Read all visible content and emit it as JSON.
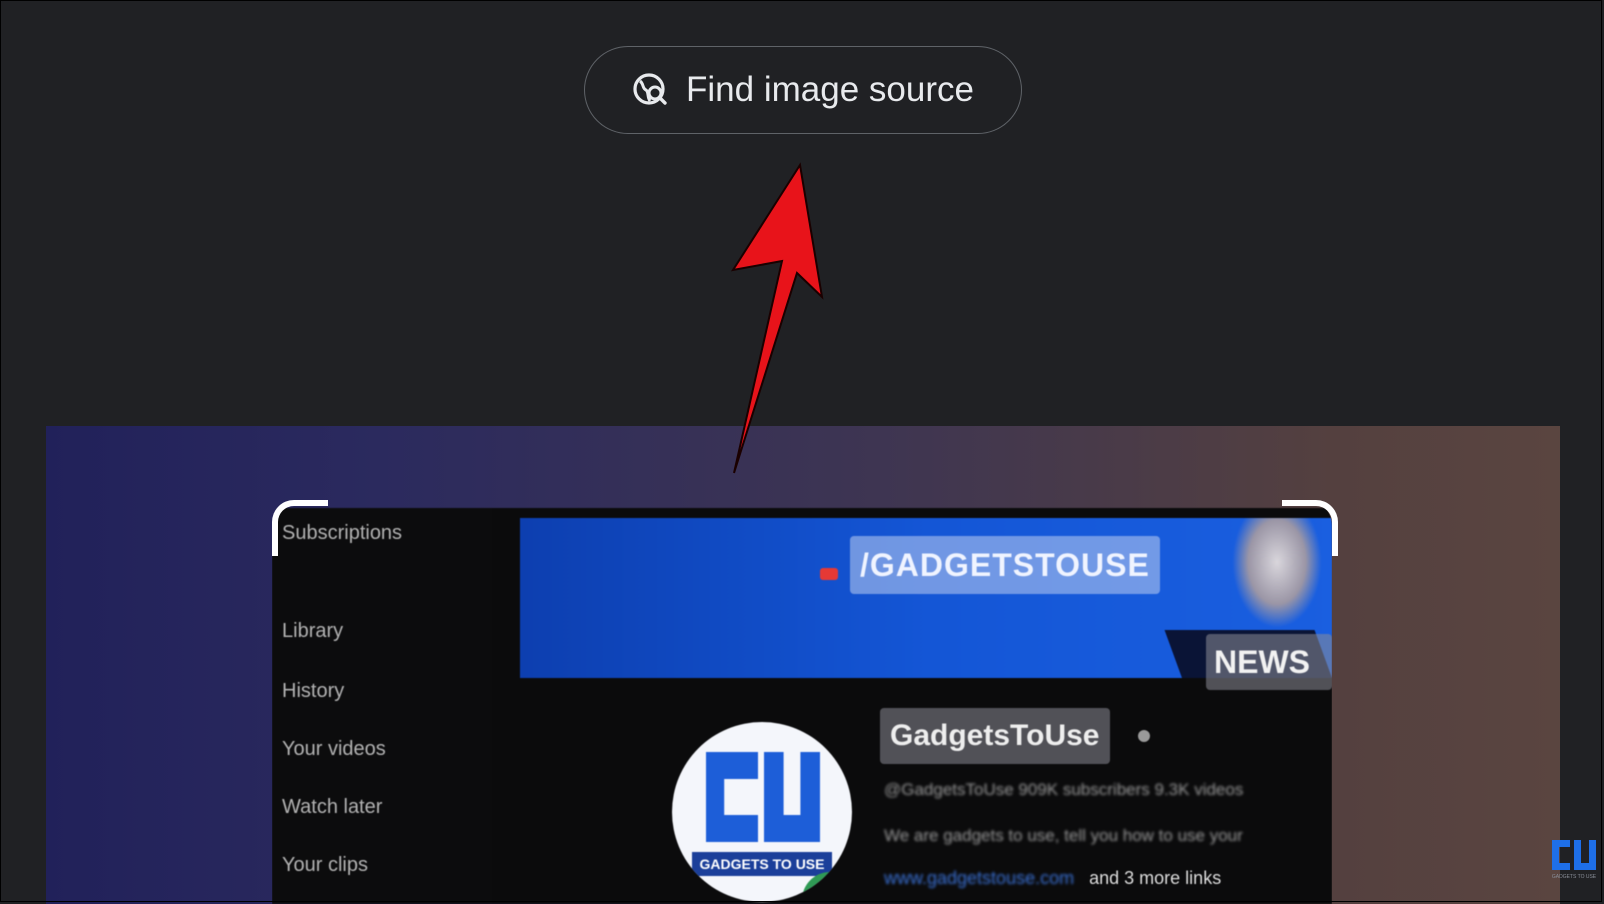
{
  "find_button": {
    "label": "Find image source",
    "icon": "lens-search-icon"
  },
  "annotation": {
    "arrow_color": "#e8131a"
  },
  "preview": {
    "nav_items": [
      "Subscriptions",
      "Library",
      "History",
      "Your videos",
      "Watch later",
      "Your clips"
    ],
    "banner_handle": "/GADGETSTOUSE",
    "banner_tag": "NEWS",
    "avatar_text": "GADGETS TO USE",
    "channel_name": "GadgetsToUse",
    "channel_meta": "@GadgetsToUse  909K subscribers  9.3K videos",
    "channel_desc": "We are gadgets to use, tell you how to use your",
    "link_text": "www.gadgetstouse.com",
    "more_links": "and 3 more links"
  },
  "watermark": {
    "logo": "GU",
    "text": "GADGETS TO USE"
  }
}
